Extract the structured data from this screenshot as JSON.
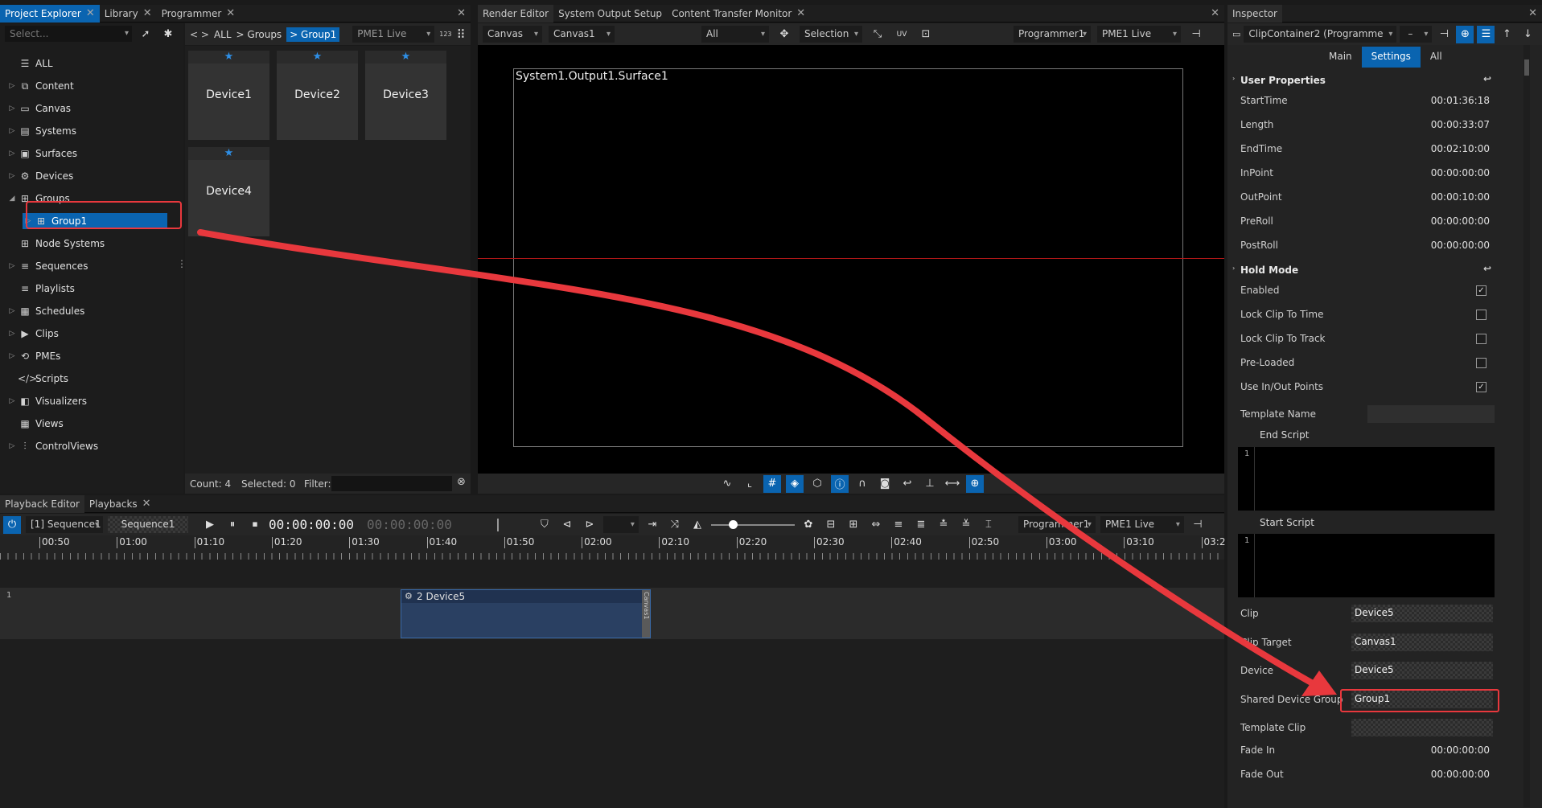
{
  "left_tabs": [
    "Project Explorer",
    "Library",
    "Programmer"
  ],
  "center_tabs": [
    "Render Editor",
    "System Output Setup",
    "Content Transfer Monitor"
  ],
  "inspector_tab": "Inspector",
  "bottom_tabs": [
    "Playback Editor",
    "Playbacks"
  ],
  "explorer": {
    "select_placeholder": "Select...",
    "tree": [
      {
        "label": "ALL",
        "icon": "☰"
      },
      {
        "label": "Content",
        "icon": "⧉"
      },
      {
        "label": "Canvas",
        "icon": "▭"
      },
      {
        "label": "Systems",
        "icon": "▤"
      },
      {
        "label": "Surfaces",
        "icon": "▣"
      },
      {
        "label": "Devices",
        "icon": "⚙"
      },
      {
        "label": "Groups",
        "icon": "⊞"
      },
      {
        "label": "Group1",
        "icon": "⊞"
      },
      {
        "label": "Node Systems",
        "icon": "⊞"
      },
      {
        "label": "Sequences",
        "icon": "≡"
      },
      {
        "label": "Playlists",
        "icon": "≡"
      },
      {
        "label": "Schedules",
        "icon": "▦"
      },
      {
        "label": "Clips",
        "icon": "▶"
      },
      {
        "label": "PMEs",
        "icon": "⟲"
      },
      {
        "label": "Scripts",
        "icon": "</>"
      },
      {
        "label": "Visualizers",
        "icon": "◧"
      },
      {
        "label": "Views",
        "icon": "▦"
      },
      {
        "label": "ControlViews",
        "icon": "⫶"
      }
    ]
  },
  "breadcrumb": {
    "nav": "< >",
    "all": "ALL",
    "groups": "> Groups",
    "group1": "> Group1",
    "pme": "PME1 Live",
    "num": "123"
  },
  "devices": [
    "Device1",
    "Device2",
    "Device3",
    "Device4"
  ],
  "device_status": {
    "count": "Count: 4",
    "selected": "Selected: 0",
    "filter": "Filter:"
  },
  "render": {
    "canvas": "Canvas",
    "canvas1": "Canvas1",
    "all": "All",
    "selection": "Selection",
    "programmer": "Programmer1",
    "pme": "PME1 Live",
    "surface": "System1.Output1.Surface1",
    "uv": "UV"
  },
  "inspector": {
    "object": "ClipContainer2 (Programme",
    "tabs": [
      "Main",
      "Settings",
      "All"
    ],
    "user_properties": "User Properties",
    "times": [
      {
        "k": "StartTime",
        "v": "00:01:36:18"
      },
      {
        "k": "Length",
        "v": "00:00:33:07"
      },
      {
        "k": "EndTime",
        "v": "00:02:10:00"
      },
      {
        "k": "InPoint",
        "v": "00:00:00:00"
      },
      {
        "k": "OutPoint",
        "v": "00:00:10:00"
      },
      {
        "k": "PreRoll",
        "v": "00:00:00:00"
      },
      {
        "k": "PostRoll",
        "v": "00:00:00:00"
      }
    ],
    "hold_mode": "Hold Mode",
    "checks": [
      {
        "k": "Enabled",
        "v": "✓"
      },
      {
        "k": "Lock Clip To Time",
        "v": ""
      },
      {
        "k": "Lock Clip To Track",
        "v": ""
      },
      {
        "k": "Pre-Loaded",
        "v": ""
      },
      {
        "k": "Use In/Out Points",
        "v": "✓"
      }
    ],
    "template_name": "Template Name",
    "end_script": "End Script",
    "start_script": "Start Script",
    "line_no": "1",
    "clip": {
      "k": "Clip",
      "v": "Device5"
    },
    "clip_target": {
      "k": "Clip Target",
      "v": "Canvas1"
    },
    "device": {
      "k": "Device",
      "v": "Device5"
    },
    "shared": {
      "k": "Shared Device Group",
      "v": "Group1"
    },
    "template_clip": "Template Clip",
    "fade_in": {
      "k": "Fade In",
      "v": "00:00:00:00"
    },
    "fade_out": {
      "k": "Fade Out",
      "v": "00:00:00:00"
    }
  },
  "playback": {
    "sequence": "[1] Sequence1",
    "seq_name": "Sequence1",
    "timecode": "00:00:00:00",
    "timecode2": "00:00:00:00",
    "programmer": "Programmer1",
    "pme": "PME1 Live",
    "ruler": [
      "00:50",
      "01:00",
      "01:10",
      "01:20",
      "01:30",
      "01:40",
      "01:50",
      "02:00",
      "02:10",
      "02:20",
      "02:30",
      "02:40",
      "02:50",
      "03:00",
      "03:10",
      "03:2"
    ],
    "track_no": "1",
    "clip_label": "2 Device5",
    "clip_side": "Canvas1"
  },
  "colors": {
    "accent": "#0a64b0",
    "annotation": "#e8383d"
  }
}
